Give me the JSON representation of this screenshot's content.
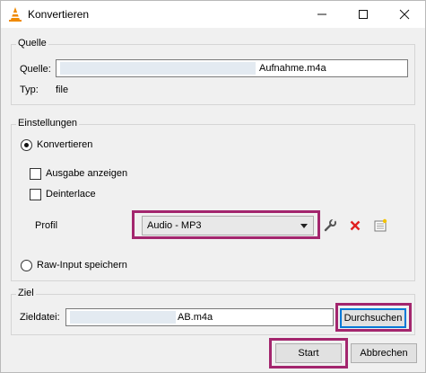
{
  "window": {
    "title": "Konvertieren"
  },
  "source": {
    "group_label": "Quelle",
    "source_label": "Quelle:",
    "source_value": "Aufnahme.m4a",
    "type_label": "Typ:",
    "type_value": "file"
  },
  "settings": {
    "group_label": "Einstellungen",
    "convert_label": "Konvertieren",
    "show_output_label": "Ausgabe anzeigen",
    "deinterlace_label": "Deinterlace",
    "profile_label": "Profil",
    "profile_value": "Audio - MP3",
    "raw_input_label": "Raw-Input speichern"
  },
  "target": {
    "group_label": "Ziel",
    "file_label": "Zieldatei:",
    "file_value": "AB.m4a",
    "browse_label": "Durchsuchen"
  },
  "footer": {
    "start_label": "Start",
    "cancel_label": "Abbrechen"
  },
  "colors": {
    "highlight": "#a3266e",
    "accent": "#0078d7"
  }
}
